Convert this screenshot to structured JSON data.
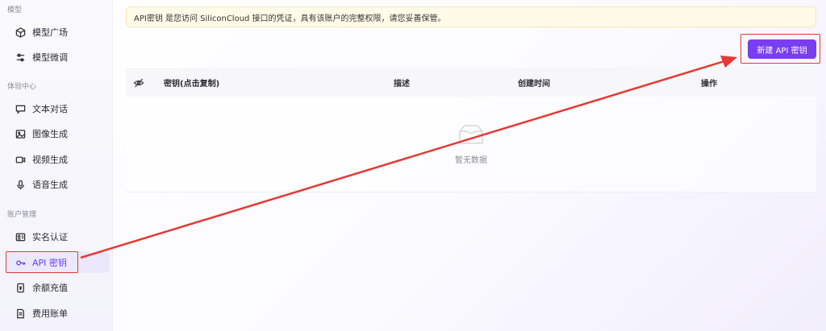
{
  "sidebar": {
    "sections": [
      {
        "label": "模型"
      },
      {
        "label": "体验中心"
      },
      {
        "label": "账户管理"
      }
    ],
    "items": [
      {
        "label": "模型广场",
        "icon": "cube-icon"
      },
      {
        "label": "模型微调",
        "icon": "sliders-icon"
      },
      {
        "label": "文本对话",
        "icon": "chat-icon"
      },
      {
        "label": "图像生成",
        "icon": "image-icon"
      },
      {
        "label": "视频生成",
        "icon": "video-icon"
      },
      {
        "label": "语音生成",
        "icon": "microphone-icon"
      },
      {
        "label": "实名认证",
        "icon": "id-card-icon"
      },
      {
        "label": "API 密钥",
        "icon": "key-icon",
        "active": true
      },
      {
        "label": "余额充值",
        "icon": "recharge-icon"
      },
      {
        "label": "费用账单",
        "icon": "bill-icon"
      }
    ]
  },
  "notice": {
    "text": "API密钥 是您访问 SiliconCloud 接口的凭证，具有该账户的完整权限，请您妥善保管。"
  },
  "toolbar": {
    "new_key_label": "新建 API 密钥"
  },
  "table": {
    "columns": [
      "密钥(点击复制)",
      "描述",
      "创建时间",
      "操作"
    ],
    "empty_text": "暂无数据"
  },
  "colors": {
    "accent": "#7a3ef0",
    "annotation": "#e53935",
    "notice_bg": "#fffbe8"
  }
}
